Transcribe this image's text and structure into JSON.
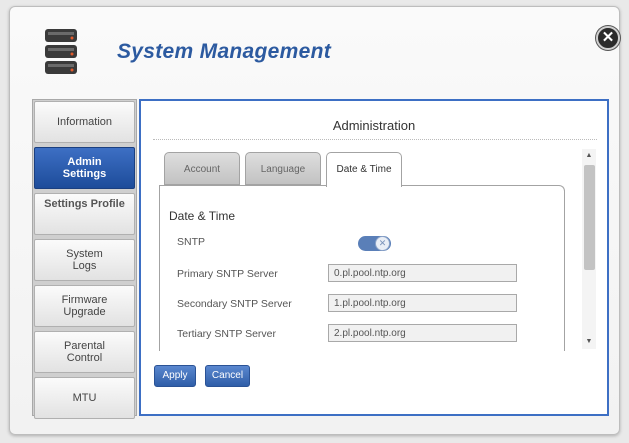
{
  "window": {
    "title": "System Management",
    "close_symbol": "✕",
    "app_icon": "database-icon"
  },
  "sidebar": {
    "items": [
      {
        "label": "Information",
        "active": false
      },
      {
        "label": "Admin\nSettings",
        "active": true
      },
      {
        "label": "Settings Profile",
        "active": false
      },
      {
        "label": "System\nLogs",
        "active": false
      },
      {
        "label": "Firmware\nUpgrade",
        "active": false
      },
      {
        "label": "Parental\nControl",
        "active": false
      },
      {
        "label": "MTU",
        "active": false
      }
    ]
  },
  "main": {
    "section_title": "Administration",
    "tabs": [
      {
        "label": "Account",
        "active": false
      },
      {
        "label": "Language",
        "active": false
      },
      {
        "label": "Date & Time",
        "active": true
      }
    ],
    "panel": {
      "heading": "Date & Time",
      "sntp_label": "SNTP",
      "sntp_enabled": true,
      "fields": [
        {
          "label": "Primary SNTP Server",
          "value": "0.pl.pool.ntp.org"
        },
        {
          "label": "Secondary SNTP Server",
          "value": "1.pl.pool.ntp.org"
        },
        {
          "label": "Tertiary SNTP Server",
          "value": "2.pl.pool.ntp.org"
        }
      ]
    },
    "apply_label": "Apply",
    "cancel_label": "Cancel"
  },
  "colors": {
    "accent": "#2c5aa0",
    "active_tab": "#1d4c9a",
    "toggle_on": "#5a7fb8"
  }
}
